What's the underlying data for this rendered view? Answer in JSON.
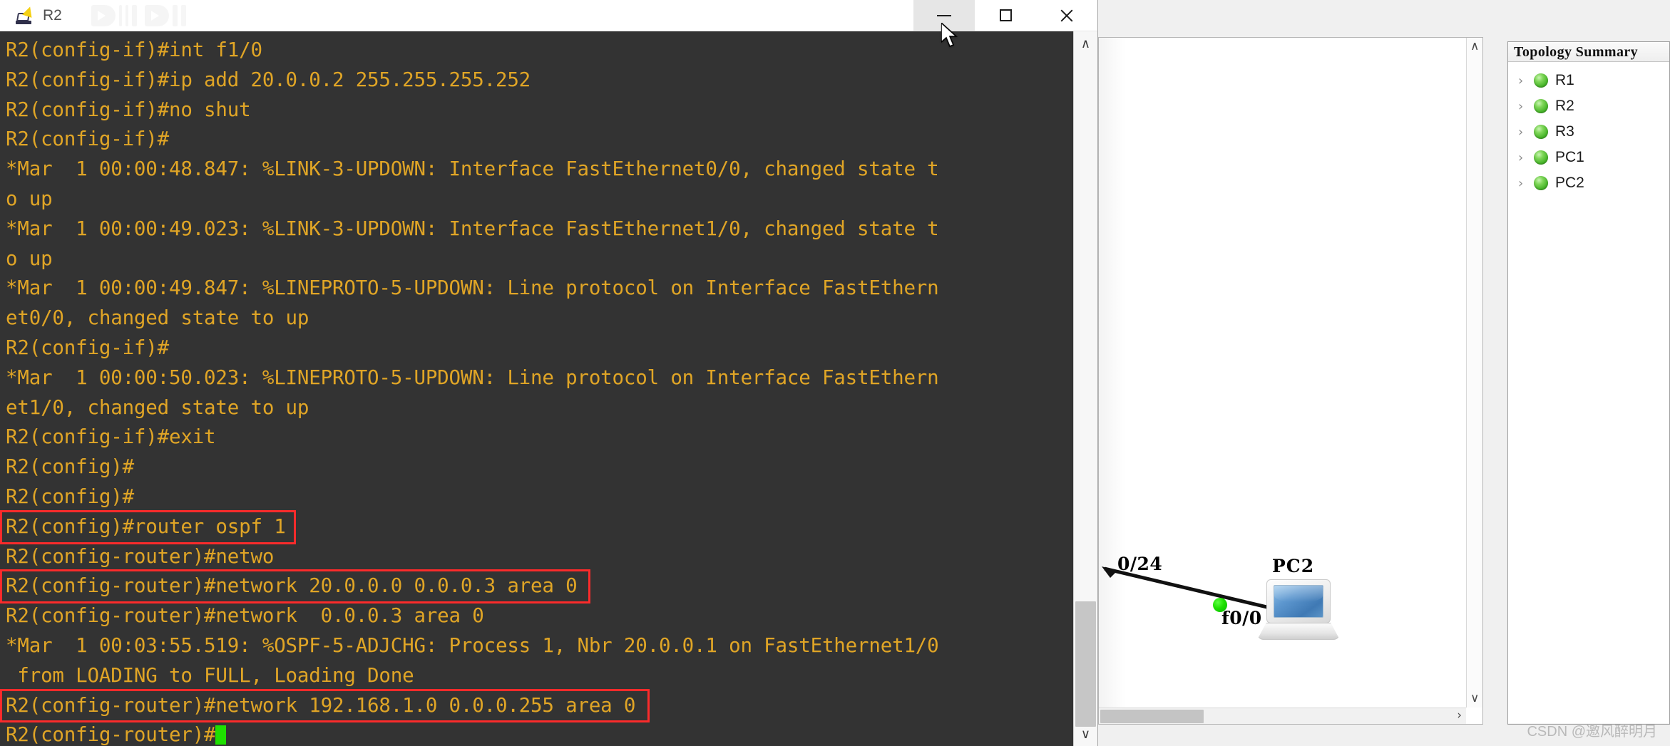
{
  "window": {
    "title": "R2",
    "icon_name": "router-console-icon",
    "watermark_logo": "bilibili-watermark",
    "controls": {
      "minimize_label": "—",
      "maximize_label": "☐",
      "close_label": "✕",
      "minimize_state": "hover"
    }
  },
  "terminal": {
    "background_color": "#333333",
    "text_color": "#e0a526",
    "cursor_color": "#1ee000",
    "highlight_color": "#fb2b2b",
    "lines": [
      "R2(config-if)#int f1/0",
      "R2(config-if)#ip add 20.0.0.2 255.255.255.252",
      "R2(config-if)#no shut",
      "R2(config-if)#",
      "*Mar  1 00:00:48.847: %LINK-3-UPDOWN: Interface FastEthernet0/0, changed state t",
      "o up",
      "*Mar  1 00:00:49.023: %LINK-3-UPDOWN: Interface FastEthernet1/0, changed state t",
      "o up",
      "*Mar  1 00:00:49.847: %LINEPROTO-5-UPDOWN: Line protocol on Interface FastEthern",
      "et0/0, changed state to up",
      "R2(config-if)#",
      "*Mar  1 00:00:50.023: %LINEPROTO-5-UPDOWN: Line protocol on Interface FastEthern",
      "et1/0, changed state to up",
      "R2(config-if)#exit",
      "R2(config)#",
      "R2(config)#",
      "R2(config)#router ospf 1",
      "R2(config-router)#netwo",
      "R2(config-router)#network 20.0.0.0 0.0.0.3 area 0",
      "R2(config-router)#network  0.0.0.3 area 0",
      "*Mar  1 00:03:55.519: %OSPF-5-ADJCHG: Process 1, Nbr 20.0.0.1 on FastEthernet1/0",
      " from LOADING to FULL, Loading Done",
      "R2(config-router)#network 192.168.1.0 0.0.0.255 area 0",
      "R2(config-router)#"
    ],
    "cursor_line_index": 23,
    "highlights": [
      {
        "line_index": 16,
        "label": "router-ospf-command"
      },
      {
        "line_index": 18,
        "label": "network-20-command"
      },
      {
        "line_index": 22,
        "label": "network-192-command"
      }
    ],
    "scrollbar": {
      "up_arrow": "∧",
      "down_arrow": "∨"
    }
  },
  "topology_panel": {
    "title": "Topology Summary",
    "nodes": [
      {
        "label": "R1",
        "chevron": "›",
        "status": "running"
      },
      {
        "label": "R2",
        "chevron": "›",
        "status": "running"
      },
      {
        "label": "R3",
        "chevron": "›",
        "status": "running"
      },
      {
        "label": "PC1",
        "chevron": "›",
        "status": "running"
      },
      {
        "label": "PC2",
        "chevron": "›",
        "status": "running"
      }
    ]
  },
  "canvas": {
    "device_label": "PC2",
    "link_label": "0/24",
    "interface_label": "f0/0",
    "scroll_up_arrow": "∧",
    "scroll_down_arrow": "∨",
    "scroll_right_arrow": "›"
  },
  "footer": {
    "watermark": "CSDN @邀风醉明月"
  }
}
